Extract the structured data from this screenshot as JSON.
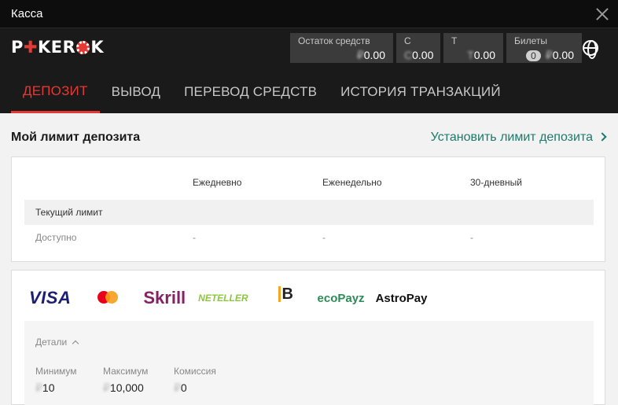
{
  "window": {
    "title": "Касса"
  },
  "brand": {
    "logo_p": "P",
    "logo_plus": "✚",
    "logo_ker": "KER",
    "logo_k": "K"
  },
  "balances": [
    {
      "label": "Остаток средств",
      "value": "0.00",
      "masked_prefix": "₽"
    },
    {
      "label": "С",
      "value": "0.00",
      "masked_prefix": "С"
    },
    {
      "label": "Т",
      "value": "0.00",
      "masked_prefix": "Т"
    },
    {
      "label": "Билеты",
      "badge": "0",
      "value": "0.00",
      "masked_prefix": "₽"
    }
  ],
  "tabs": [
    {
      "label": "ДЕПОЗИТ",
      "active": true
    },
    {
      "label": "ВЫВОД"
    },
    {
      "label": "ПЕРЕВОД СРЕДСТВ"
    },
    {
      "label": "ИСТОРИЯ ТРАНЗАКЦИЙ"
    }
  ],
  "limit": {
    "title": "Мой лимит депозита",
    "link": "Установить лимит депозита",
    "columns": [
      "Ежедневно",
      "Еженедельно",
      "30-дневный"
    ],
    "rows": [
      {
        "label": "Текущий лимит",
        "values": [
          "",
          "",
          ""
        ]
      },
      {
        "label": "Доступно",
        "values": [
          "-",
          "-",
          "-"
        ]
      }
    ]
  },
  "payments": {
    "methods": [
      "VISA",
      "mastercard",
      "Skrill",
      "NETELLER",
      "MuchBetter",
      "ecoPayz",
      "AstroPay"
    ],
    "details_label": "Детали",
    "stats": [
      {
        "label": "Минимум",
        "value": "10"
      },
      {
        "label": "Максимум",
        "value": "10,000"
      },
      {
        "label": "Комиссия",
        "value": "0"
      }
    ]
  }
}
